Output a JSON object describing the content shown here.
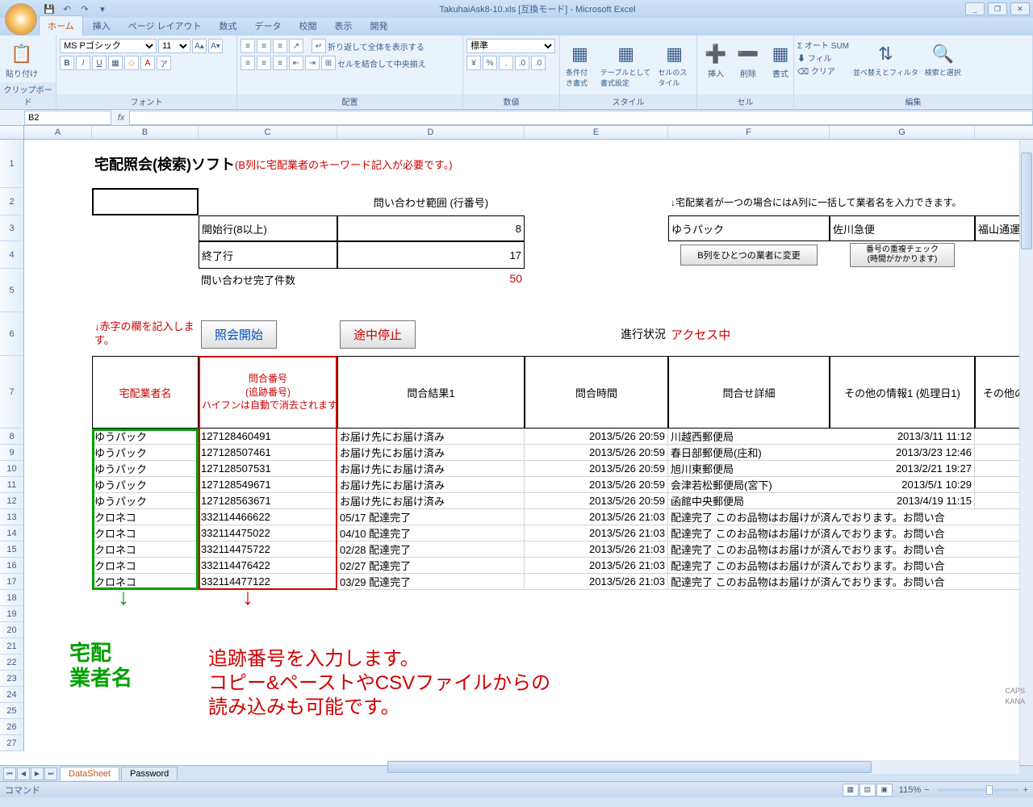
{
  "window": {
    "title": "TakuhaiAsk8-10.xls [互換モード] - Microsoft Excel"
  },
  "tabs": {
    "home": "ホーム",
    "insert": "挿入",
    "layout": "ページ レイアウト",
    "formulas": "数式",
    "data": "データ",
    "review": "校閲",
    "view": "表示",
    "dev": "開発"
  },
  "ribbon": {
    "clipboard": {
      "label": "クリップボード",
      "paste": "貼り付け"
    },
    "font": {
      "label": "フォント",
      "name": "MS Pゴシック",
      "size": "11"
    },
    "align": {
      "label": "配置",
      "wrap": "折り返して全体を表示する",
      "merge": "セルを結合して中央揃え"
    },
    "number": {
      "label": "数値",
      "format": "標準"
    },
    "style": {
      "label": "スタイル",
      "cond": "条件付き書式",
      "table": "テーブルとして書式設定",
      "cell": "セルのスタイル"
    },
    "cells": {
      "label": "セル",
      "insert": "挿入",
      "delete": "削除",
      "format": "書式"
    },
    "editing": {
      "label": "編集",
      "autosum": "Σ オート SUM",
      "fill": "フィル",
      "clear": "クリア",
      "sort": "並べ替えとフィルタ",
      "find": "検索と選択"
    }
  },
  "namebox": "B2",
  "cols": [
    "A",
    "B",
    "C",
    "D",
    "E",
    "F",
    "G"
  ],
  "sheet": {
    "title": "宅配照会(検索)ソフト",
    "title_note": "(B列に宅配業者のキーワード記入が必要です。)",
    "range_label": "問い合わせ範囲 (行番号)",
    "note_right": "↓宅配業者が一つの場合にはA列に一括して業者名を入力できます。",
    "start_label": "開始行(8以上)",
    "start_val": "8",
    "end_label": "終了行",
    "end_val": "17",
    "f3": "ゆうパック",
    "g3": "佐川急便",
    "h3": "福山通運",
    "btn_change": "B列をひとつの業者に変更",
    "btn_dup": "番号の重複チェック\n(時間がかかります)",
    "count_label": "問い合わせ完了件数",
    "count_val": "50",
    "red_note": "↓赤字の欄を記入します。",
    "btn_start": "照会開始",
    "btn_stop": "途中停止",
    "progress_label": "進行状況",
    "progress_val": "アクセス中",
    "hdr_b": "宅配業者名",
    "hdr_c1": "問合番号",
    "hdr_c2": "(追跡番号)",
    "hdr_c3": "ハイフンは自動で消去されます。)",
    "hdr_d": "問合結果1",
    "hdr_e": "問合時間",
    "hdr_f": "問合せ詳細",
    "hdr_g": "その他の情報1 (処理日1)",
    "hdr_h": "その他の"
  },
  "rows": [
    {
      "b": "ゆうパック",
      "c": "127128460491",
      "d": "お届け先にお届け済み",
      "e": "2013/5/26 20:59",
      "f": "川越西郵便局",
      "g": "2013/3/11 11:12"
    },
    {
      "b": "ゆうパック",
      "c": "127128507461",
      "d": "お届け先にお届け済み",
      "e": "2013/5/26 20:59",
      "f": "春日部郵便局(庄和)",
      "g": "2013/3/23 12:46"
    },
    {
      "b": "ゆうパック",
      "c": "127128507531",
      "d": "お届け先にお届け済み",
      "e": "2013/5/26 20:59",
      "f": "旭川東郵便局",
      "g": "2013/2/21 19:27"
    },
    {
      "b": "ゆうパック",
      "c": "127128549671",
      "d": "お届け先にお届け済み",
      "e": "2013/5/26 20:59",
      "f": "会津若松郵便局(宮下)",
      "g": "2013/5/1 10:29"
    },
    {
      "b": "ゆうパック",
      "c": "127128563671",
      "d": "お届け先にお届け済み",
      "e": "2013/5/26 20:59",
      "f": "函館中央郵便局",
      "g": "2013/4/19 11:15"
    },
    {
      "b": "クロネコ",
      "c": "332114466622",
      "d": "05/17 配達完了",
      "e": "2013/5/26 21:03",
      "f": "配達完了 このお品物はお届けが済んでおります。お問い合",
      "g": ""
    },
    {
      "b": "クロネコ",
      "c": "332114475022",
      "d": "04/10 配達完了",
      "e": "2013/5/26 21:03",
      "f": "配達完了 このお品物はお届けが済んでおります。お問い合",
      "g": ""
    },
    {
      "b": "クロネコ",
      "c": "332114475722",
      "d": "02/28 配達完了",
      "e": "2013/5/26 21:03",
      "f": "配達完了 このお品物はお届けが済んでおります。お問い合",
      "g": ""
    },
    {
      "b": "クロネコ",
      "c": "332114476422",
      "d": "02/27 配達完了",
      "e": "2013/5/26 21:03",
      "f": "配達完了 このお品物はお届けが済んでおります。お問い合",
      "g": ""
    },
    {
      "b": "クロネコ",
      "c": "332114477122",
      "d": "03/29 配達完了",
      "e": "2013/5/26 21:03",
      "f": "配達完了 このお品物はお届けが済んでおります。お問い合",
      "g": ""
    }
  ],
  "annot": {
    "green": "宅配\n業者名",
    "red1": "追跡番号を入力します。",
    "red2": "コピー&ペーストやCSVファイルからの",
    "red3": "読み込みも可能です。"
  },
  "sheet_tabs": {
    "s1": "DataSheet",
    "s2": "Password"
  },
  "status": {
    "cmd": "コマンド",
    "zoom": "115%",
    "caps": "CAPS",
    "kana": "KANA"
  }
}
